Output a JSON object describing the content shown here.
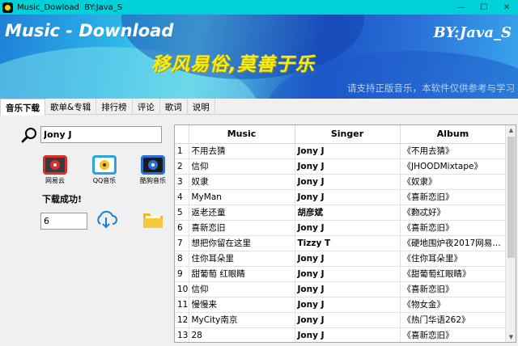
{
  "window": {
    "title": "Music_Dowload  BY:Java_S",
    "minimize": "—",
    "maximize": "☐",
    "close": "✕"
  },
  "banner": {
    "title": "Music - Download",
    "author": "BY:Java_S",
    "slogan": "移风易俗,莫善于乐",
    "notice": "请支持正版音乐，本软件仅供参考与学习"
  },
  "tabs": [
    {
      "label": "音乐下载",
      "active": true
    },
    {
      "label": "歌单&专辑",
      "active": false
    },
    {
      "label": "排行榜",
      "active": false
    },
    {
      "label": "评论",
      "active": false
    },
    {
      "label": "歌词",
      "active": false
    },
    {
      "label": "说明",
      "active": false
    }
  ],
  "search": {
    "value": "Jony J"
  },
  "sources": [
    {
      "label": "网易云",
      "icon": "netease-music-icon",
      "color": "#d8302a"
    },
    {
      "label": "QQ音乐",
      "icon": "qq-music-icon",
      "color": "#2aa5e0"
    },
    {
      "label": "酷狗音乐",
      "icon": "kugou-music-icon",
      "color": "#2a6fd6"
    }
  ],
  "status": "下载成功!",
  "download_count": "6",
  "table": {
    "headers": {
      "music": "Music",
      "singer": "Singer",
      "album": "Album"
    },
    "rows": [
      {
        "num": "1",
        "music": "不用去猜",
        "singer": "Jony J",
        "album": "《不用去猜》"
      },
      {
        "num": "2",
        "music": "信仰",
        "singer": "Jony J",
        "album": "《JHOODMixtape》"
      },
      {
        "num": "3",
        "music": "奴隶",
        "singer": "Jony J",
        "album": "《奴隶》"
      },
      {
        "num": "4",
        "music": "MyMan",
        "singer": "Jony J",
        "album": "《喜新恋旧》"
      },
      {
        "num": "5",
        "music": "返老还童",
        "singer": "胡彦斌",
        "album": "《覅忒好》"
      },
      {
        "num": "6",
        "music": "喜新恋旧",
        "singer": "Jony J",
        "album": "《喜新恋旧》"
      },
      {
        "num": "7",
        "music": "想把你留在这里",
        "singer": "Tizzy T",
        "album": "《硬地围炉夜2017网易云..."
      },
      {
        "num": "8",
        "music": "住你耳朵里",
        "singer": "Jony J",
        "album": "《住你耳朵里》"
      },
      {
        "num": "9",
        "music": "甜葡萄 红眼睛",
        "singer": "Jony J",
        "album": "《甜葡萄红眼睛》"
      },
      {
        "num": "10",
        "music": "信仰",
        "singer": "Jony J",
        "album": "《喜新恋旧》"
      },
      {
        "num": "11",
        "music": "慢慢来",
        "singer": "Jony J",
        "album": "《物女金》"
      },
      {
        "num": "12",
        "music": "MyCity南京",
        "singer": "Jony J",
        "album": "《热门华语262》"
      },
      {
        "num": "13",
        "music": "28",
        "singer": "Jony J",
        "album": "《喜新恋旧》"
      }
    ]
  },
  "colors": {
    "titlebar": "#00d0d8",
    "slogan": "#f4ec1c",
    "banner_blue": "#1b56c6"
  }
}
